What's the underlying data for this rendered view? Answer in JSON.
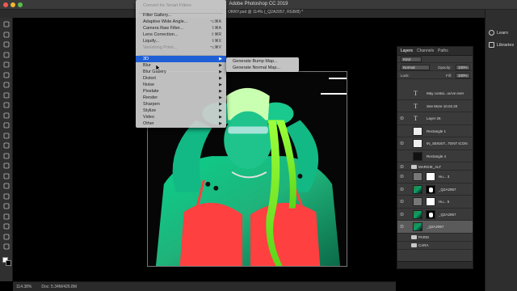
{
  "window": {
    "app_title": "Adobe Photoshop CC 2019",
    "doc_title": "ORRY.psd @ 114% (_Q2A2957, RGB/8) *"
  },
  "right_panel": {
    "learn": "Learn",
    "libraries": "Libraries"
  },
  "filter_menu": {
    "items": [
      {
        "label": "Convert for Smart Filters",
        "disabled": true
      },
      {
        "label": "Filter Gallery..."
      },
      {
        "label": "Adaptive Wide Angle...",
        "shortcut": "⌥⌘A"
      },
      {
        "label": "Camera Raw Filter...",
        "shortcut": "⇧⌘A"
      },
      {
        "label": "Lens Correction...",
        "shortcut": "⇧⌘R"
      },
      {
        "label": "Liquify...",
        "shortcut": "⇧⌘X"
      },
      {
        "label": "Vanishing Point...",
        "shortcut": "⌥⌘V",
        "disabled": true
      },
      {
        "label": "3D",
        "submenu": true,
        "selected": true
      },
      {
        "label": "Blur",
        "submenu": true
      },
      {
        "label": "Blur Gallery",
        "submenu": true
      },
      {
        "label": "Distort",
        "submenu": true
      },
      {
        "label": "Noise",
        "submenu": true
      },
      {
        "label": "Pixelate",
        "submenu": true
      },
      {
        "label": "Render",
        "submenu": true
      },
      {
        "label": "Sharpen",
        "submenu": true
      },
      {
        "label": "Stylize",
        "submenu": true
      },
      {
        "label": "Video",
        "submenu": true
      },
      {
        "label": "Other",
        "submenu": true
      }
    ],
    "submenu_3d": [
      "Generate Bump Map...",
      "Generate Normal Map..."
    ]
  },
  "layers_panel": {
    "tabs": [
      "Layers",
      "Channels",
      "Paths"
    ],
    "filter_kind": "Kind",
    "blend_mode": "Normal",
    "opacity_label": "Opacity:",
    "opacity": "100%",
    "lock_label": "Lock:",
    "fill_label": "Fill:",
    "fill": "100%",
    "layers": [
      {
        "type": "text",
        "name": "May contai...ou've ever",
        "visible": false
      },
      {
        "type": "text",
        "name": "See More 10.02.20",
        "visible": false
      },
      {
        "type": "text",
        "name": "Layer 26",
        "visible": true
      },
      {
        "type": "shape",
        "name": "Rectangle 1",
        "visible": false
      },
      {
        "type": "shape",
        "name": "IN_SENSIT...TENT ICON",
        "visible": true
      },
      {
        "type": "shape-dark",
        "name": "Rectangle 4",
        "visible": false
      },
      {
        "type": "folder",
        "name": "MARGIE_ALT",
        "visible": true
      },
      {
        "type": "adjust",
        "name": "Hu... 3",
        "visible": true
      },
      {
        "type": "pic-mask",
        "name": "_Q2A2957",
        "visible": true
      },
      {
        "type": "adjust",
        "name": "Hu... 5",
        "visible": true
      },
      {
        "type": "pic-mask",
        "name": "_Q2A2957",
        "visible": true
      },
      {
        "type": "pic",
        "name": "_Q2A2957",
        "visible": true,
        "selected": true
      },
      {
        "type": "folder",
        "name": "PARIS",
        "visible": false
      },
      {
        "type": "folder",
        "name": "CARA",
        "visible": false
      }
    ]
  },
  "status": {
    "zoom": "114.38%",
    "doc": "Doc: 5.34M/426.8M"
  },
  "colors": {
    "accent": "#1f5fd6",
    "neon_green": "#7cff2a",
    "neon_red": "#ff3b3b"
  }
}
